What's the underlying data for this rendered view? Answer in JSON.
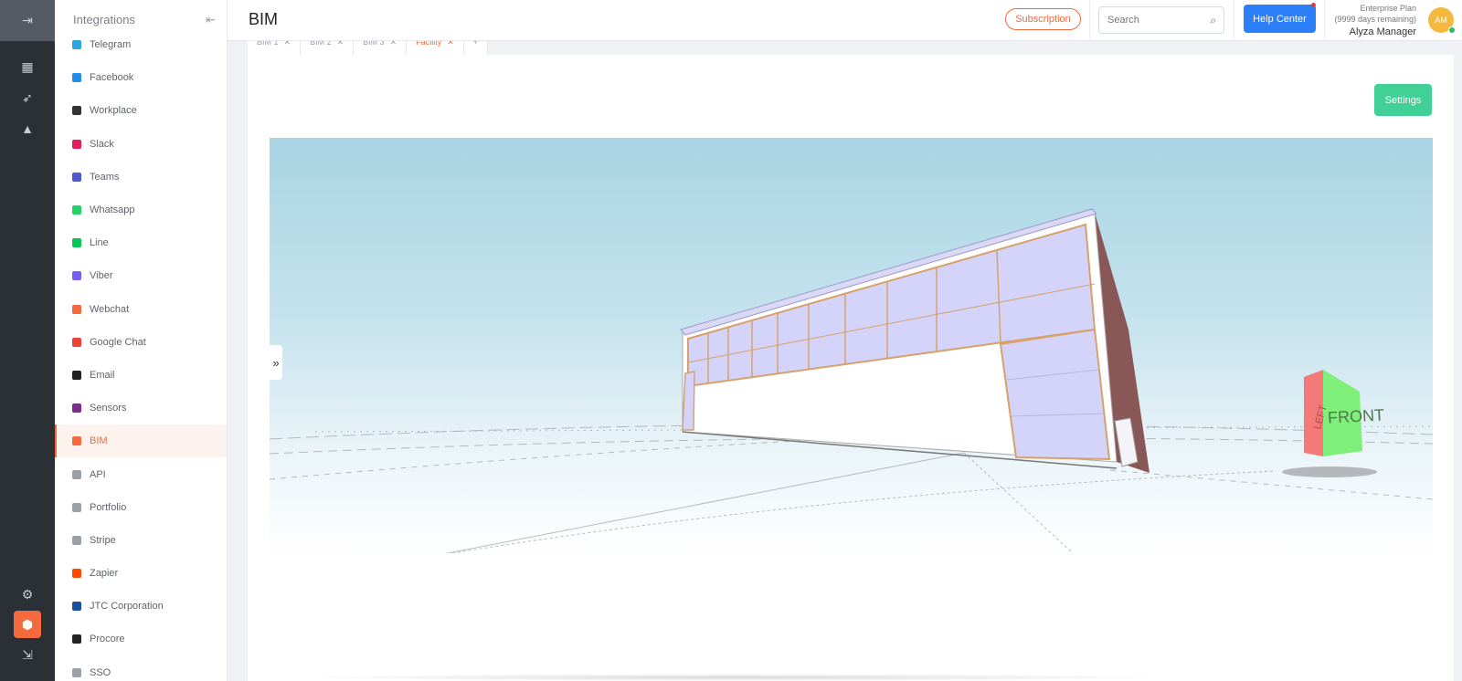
{
  "sidebar": {
    "title": "Integrations",
    "items": [
      {
        "label": "Telegram",
        "color": "#2aa5e0"
      },
      {
        "label": "Facebook",
        "color": "#1f8ce6"
      },
      {
        "label": "Workplace",
        "color": "#333333"
      },
      {
        "label": "Slack",
        "color": "#e01e5a"
      },
      {
        "label": "Teams",
        "color": "#5059c9"
      },
      {
        "label": "Whatsapp",
        "color": "#25d366"
      },
      {
        "label": "Line",
        "color": "#06c755"
      },
      {
        "label": "Viber",
        "color": "#7360f2"
      },
      {
        "label": "Webchat",
        "color": "#f26a3d"
      },
      {
        "label": "Google Chat",
        "color": "#ea4335"
      },
      {
        "label": "Email",
        "color": "#222222"
      },
      {
        "label": "Sensors",
        "color": "#7b2d8e"
      },
      {
        "label": "BIM",
        "color": "#f26a3d",
        "active": true
      },
      {
        "label": "API",
        "color": "#9aa0a6"
      },
      {
        "label": "Portfolio",
        "color": "#9aa0a6"
      },
      {
        "label": "Stripe",
        "color": "#9aa0a6"
      },
      {
        "label": "Zapier",
        "color": "#ff4a00"
      },
      {
        "label": "JTC Corporation",
        "color": "#1a4fa0"
      },
      {
        "label": "Procore",
        "color": "#222222"
      },
      {
        "label": "SSO",
        "color": "#9aa0a6"
      }
    ]
  },
  "header": {
    "page_title": "BIM",
    "subscription_label": "Subscription",
    "search_placeholder": "Search",
    "help_label": "Help Center",
    "plan_name": "Enterprise Plan",
    "plan_remaining": "(9999 days remaining)",
    "user_name": "Alyza Manager",
    "avatar_initials": "AM"
  },
  "tabs": [
    {
      "label": "BIM 1"
    },
    {
      "label": "BIM 2"
    },
    {
      "label": "BIM 3"
    },
    {
      "label": "Facility",
      "active": true
    }
  ],
  "tab_add_label": "+",
  "settings_label": "Settings",
  "viewcube": {
    "front_label": "FRONT",
    "left_label": "LEFT"
  },
  "colors": {
    "accent": "#f26a3d",
    "primary": "#2d7ff9",
    "success": "#41d197"
  }
}
